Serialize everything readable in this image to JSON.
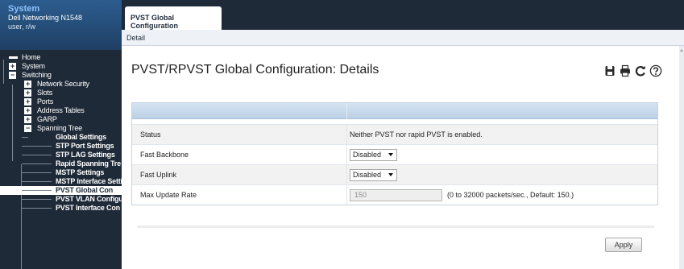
{
  "system": {
    "title": "System",
    "device": "Dell Networking N1548",
    "user": "user, r/w"
  },
  "nav": {
    "home": "Home",
    "system": "System",
    "switching": "Switching",
    "network_security": "Network Security",
    "slots": "Slots",
    "ports": "Ports",
    "address_tables": "Address Tables",
    "garp": "GARP",
    "spanning_tree": "Spanning Tree",
    "global_settings": "Global Settings",
    "stp_port_settings": "STP Port Settings",
    "stp_lag_settings": "STP LAG Settings",
    "rapid_spanning_tree": "Rapid Spanning Tre",
    "mstp_settings": "MSTP Settings",
    "mstp_interface_settings": "MSTP Interface Setti",
    "pvst_global": "PVST Global Con",
    "pvst_vlan": "PVST VLAN Configu",
    "pvst_interface": "PVST Interface Con",
    "expand_glyph": "+",
    "collapse_glyph": "−"
  },
  "tabs": {
    "active": "PVST Global Configuration",
    "sub": "Detail"
  },
  "page": {
    "title": "PVST/RPVST Global Configuration: Details"
  },
  "icons": [
    "save-icon",
    "print-icon",
    "refresh-icon",
    "help-icon"
  ],
  "form": {
    "status_label": "Status",
    "status_value": "Neither PVST nor rapid PVST is enabled.",
    "fast_backbone_label": "Fast Backbone",
    "fast_backbone_value": "Disabled",
    "fast_uplink_label": "Fast Uplink",
    "fast_uplink_value": "Disabled",
    "max_update_rate_label": "Max Update Rate",
    "max_update_rate_value": "150",
    "max_update_rate_hint": "(0 to 32000 packets/sec., Default: 150.)"
  },
  "actions": {
    "apply": "Apply"
  },
  "colors": {
    "nav_bg": "#1f2a38",
    "header_gradient_top": "#2c5d8f",
    "system_title": "#8fc3ff",
    "table_header": "#c8dbed"
  }
}
